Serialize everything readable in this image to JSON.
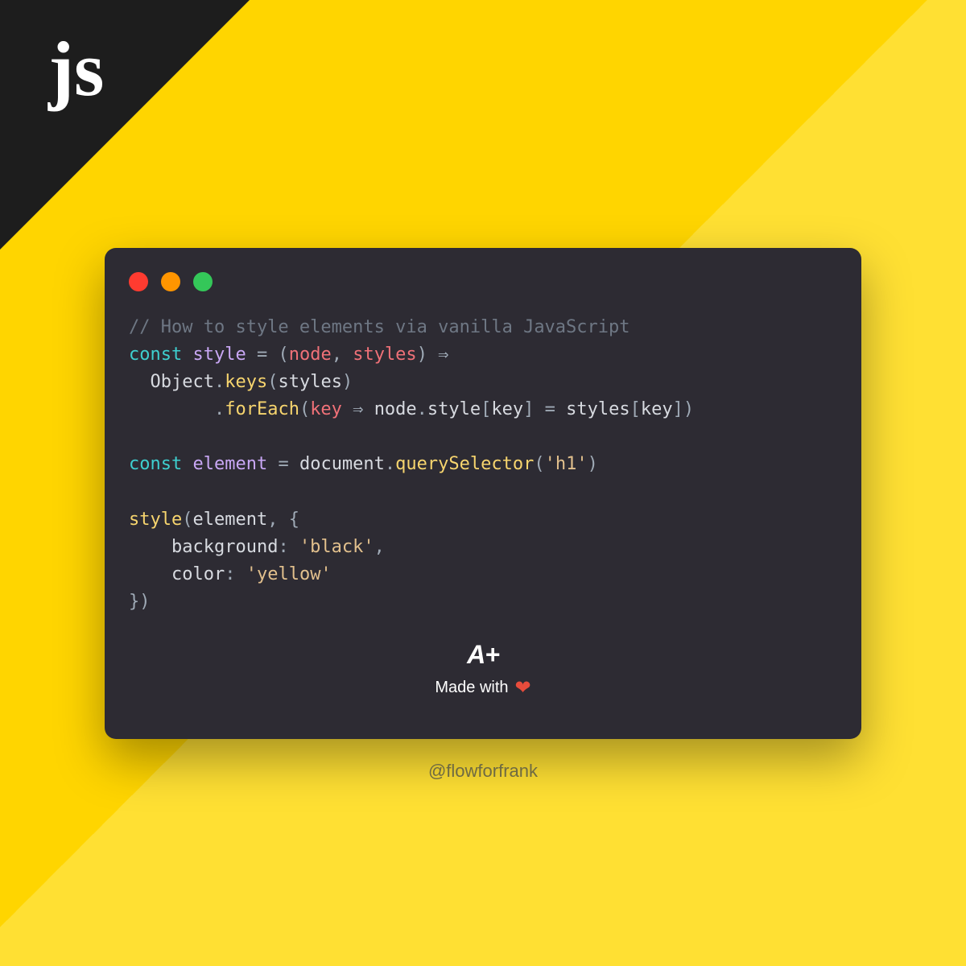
{
  "corner": {
    "label": "js"
  },
  "card": {
    "code": {
      "comment": "// How to style elements via vanilla JavaScript",
      "line1": {
        "const": "const",
        "name": "style",
        "eq": " = ",
        "paren1": "(",
        "p1": "node",
        "comma": ", ",
        "p2": "styles",
        "paren2": ")",
        "arrow": " ⇒"
      },
      "line2": {
        "indent": "  ",
        "obj": "Object",
        "dot": ".",
        "method": "keys",
        "open": "(",
        "arg": "styles",
        "close": ")"
      },
      "line3": {
        "indent": "        ",
        "dot": ".",
        "method": "forEach",
        "open": "(",
        "p": "key",
        "arrow": " ⇒ ",
        "lhs1": "node",
        "d1": ".",
        "lhs2": "style",
        "br1": "[",
        "idx": "key",
        "br2": "]",
        "eq": " = ",
        "rhs1": "styles",
        "br3": "[",
        "idx2": "key",
        "br4": "]",
        "close": ")"
      },
      "line4": {
        "const": "const",
        "name": "element",
        "eq": " = ",
        "doc": "document",
        "dot": ".",
        "method": "querySelector",
        "open": "(",
        "str": "'h1'",
        "close": ")"
      },
      "line5": {
        "fn": "style",
        "open": "(",
        "arg": "element",
        "comma": ", ",
        "brace": "{"
      },
      "line6": {
        "indent": "    ",
        "key": "background",
        "colon": ": ",
        "val": "'black'",
        "comma": ","
      },
      "line7": {
        "indent": "    ",
        "key": "color",
        "colon": ": ",
        "val": "'yellow'"
      },
      "line8": {
        "close": "})"
      }
    },
    "footer": {
      "badge": "A+",
      "made": "Made with",
      "heart": "❤"
    }
  },
  "handle": "@flowforfrank"
}
